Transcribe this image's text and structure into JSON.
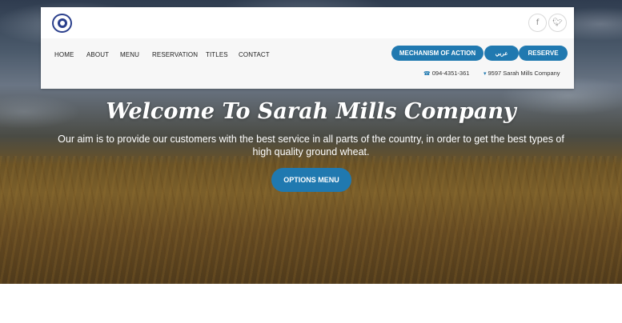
{
  "header": {
    "social": [
      {
        "icon": "facebook-icon",
        "glyph": "f"
      },
      {
        "icon": "twitter-icon",
        "glyph": "🐦"
      }
    ],
    "nav": [
      "HOME",
      "ABOUT",
      "MENU",
      "RESERVATION",
      "TITLES",
      "CONTACT"
    ],
    "buttons": {
      "mechanism": "MECHANISM OF ACTION",
      "arabic": "عربي",
      "reserve": "RESERVE"
    },
    "contact": {
      "phone": "094-4351-361",
      "address": "9597 Sarah Mills Company"
    }
  },
  "hero": {
    "title": "Welcome To Sarah Mills Company",
    "subtitle": "Our aim is to provide our customers with the best service in all parts of the country, in order to get the best types of high quality ground wheat.",
    "button": "OPTIONS MENU"
  },
  "colors": {
    "accent": "#2079b0",
    "logo": "#2a3f8c"
  }
}
